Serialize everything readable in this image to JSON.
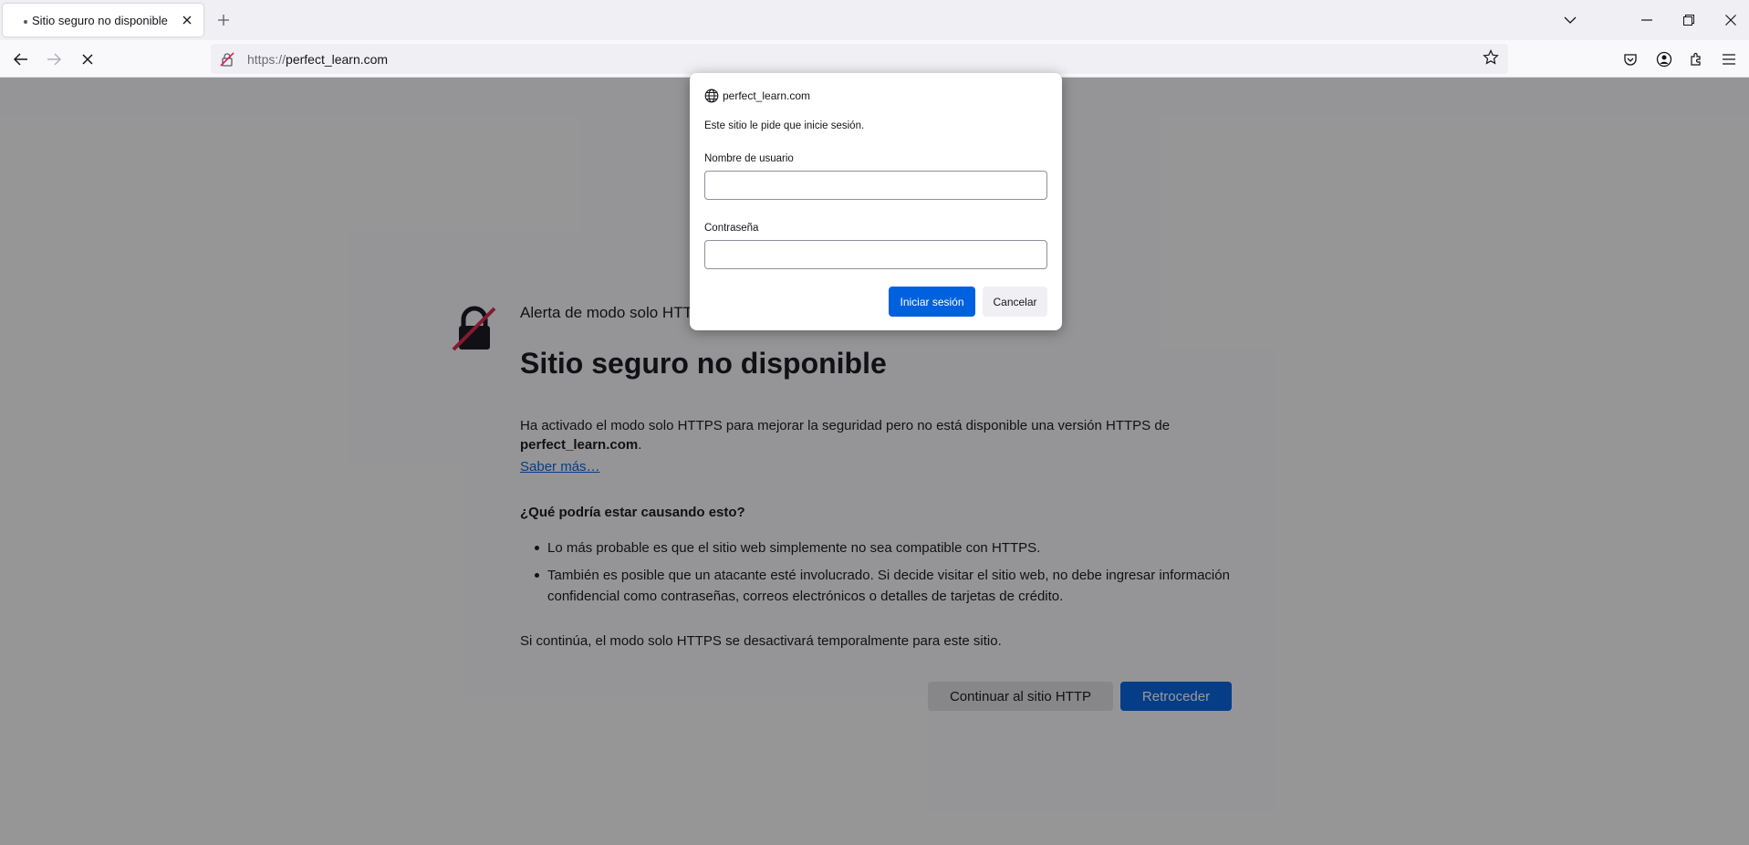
{
  "browser": {
    "tab": {
      "title": "Sitio seguro no disponible"
    },
    "url": {
      "scheme": "https://",
      "host": "perfect_learn.com"
    },
    "icons": [
      "back-icon",
      "forward-icon",
      "stop-icon",
      "lock-warning-icon",
      "bookmark-star-icon",
      "pocket-icon",
      "account-icon",
      "extensions-icon",
      "menu-icon",
      "tab-list-icon",
      "minimize-icon",
      "restore-icon",
      "close-icon",
      "new-tab-icon"
    ]
  },
  "error_page": {
    "subtitle": "Alerta de modo solo HTTPS",
    "title": "Sitio seguro no disponible",
    "intro": "Ha activado el modo solo HTTPS para mejorar la seguridad pero no está disponible una versión HTTPS de",
    "host": "perfect_learn.com",
    "learn_more": "Saber más…",
    "causes_heading": "¿Qué podría estar causando esto?",
    "causes": [
      "Lo más probable es que el sitio web simplemente no sea compatible con HTTPS.",
      "También es posible que un atacante esté involucrado. Si decide visitar el sitio web, no debe ingresar información confidencial como contraseñas, correos electrónicos o detalles de tarjetas de crédito."
    ],
    "footer_note": "Si continúa, el modo solo HTTPS se desactivará temporalmente para este sitio.",
    "continue_button": "Continuar al sitio HTTP",
    "back_button": "Retroceder"
  },
  "auth_dialog": {
    "host": "perfect_learn.com",
    "message": "Este sitio le pide que inicie sesión.",
    "username_label": "Nombre de usuario",
    "username_value": "",
    "password_label": "Contraseña",
    "password_value": "",
    "signin_button": "Iniciar sesión",
    "cancel_button": "Cancelar"
  },
  "colors": {
    "accent": "#0061e0",
    "warning_icon": "#d7264c"
  }
}
